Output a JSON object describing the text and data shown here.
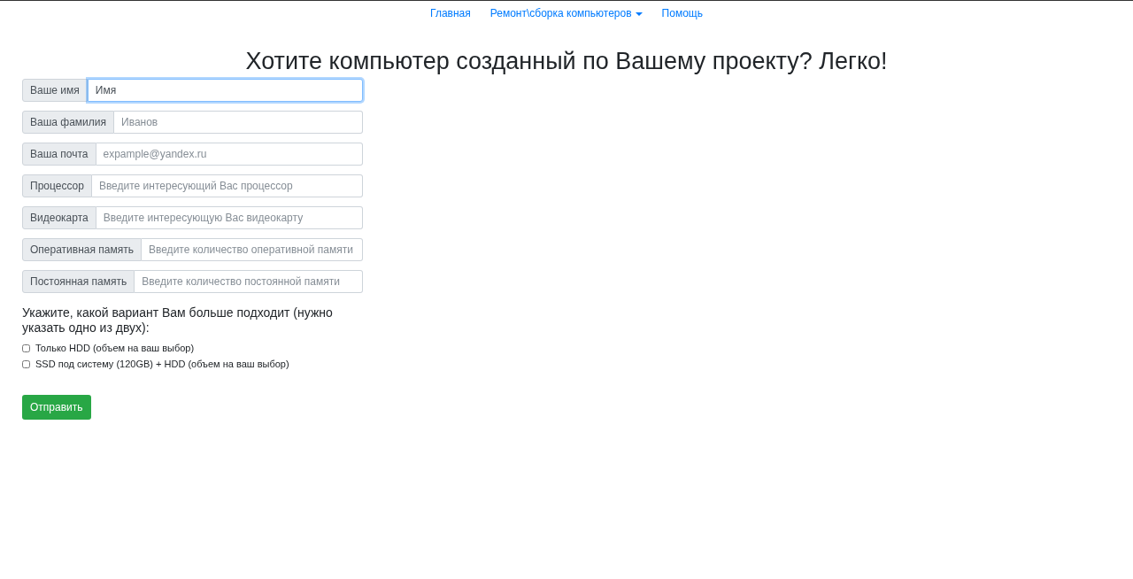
{
  "nav": [
    {
      "label": "Главная",
      "kind": "link"
    },
    {
      "label": "Ремонт\\сборка компьютеров",
      "kind": "dropdown"
    },
    {
      "label": "Помощь",
      "kind": "link"
    }
  ],
  "heading": "Хотите компьютер созданный по Вашему проекту? Легко!",
  "fields": [
    {
      "label": "Ваше имя",
      "value": "Имя",
      "focused": true
    },
    {
      "label": "Ваша фамилия",
      "placeholder": "Иванов",
      "focused": false
    },
    {
      "label": "Ваша почта",
      "placeholder": "expample@yandex.ru",
      "focused": false
    },
    {
      "label": "Процессор",
      "placeholder": "Введите интересующий Вас процессор",
      "focused": false
    },
    {
      "label": "Видеокарта",
      "placeholder": "Введите интересующую Вас видеокарту",
      "focused": false
    },
    {
      "label": "Оперативная память",
      "placeholder": "Введите количество оперативной памяти",
      "focused": false
    },
    {
      "label": "Постоянная память",
      "placeholder": "Введите количество постоянной памяти",
      "focused": false
    }
  ],
  "question": "Укажите, какой вариант Вам больше подходит (нужно указать одно из двух):",
  "options": [
    {
      "label": "Только HDD (объем на ваш выбор)",
      "checked": false
    },
    {
      "label": "SSD под систему (120GB) + HDD (объем на ваш выбор)",
      "checked": false
    }
  ],
  "submit": "Отправить"
}
